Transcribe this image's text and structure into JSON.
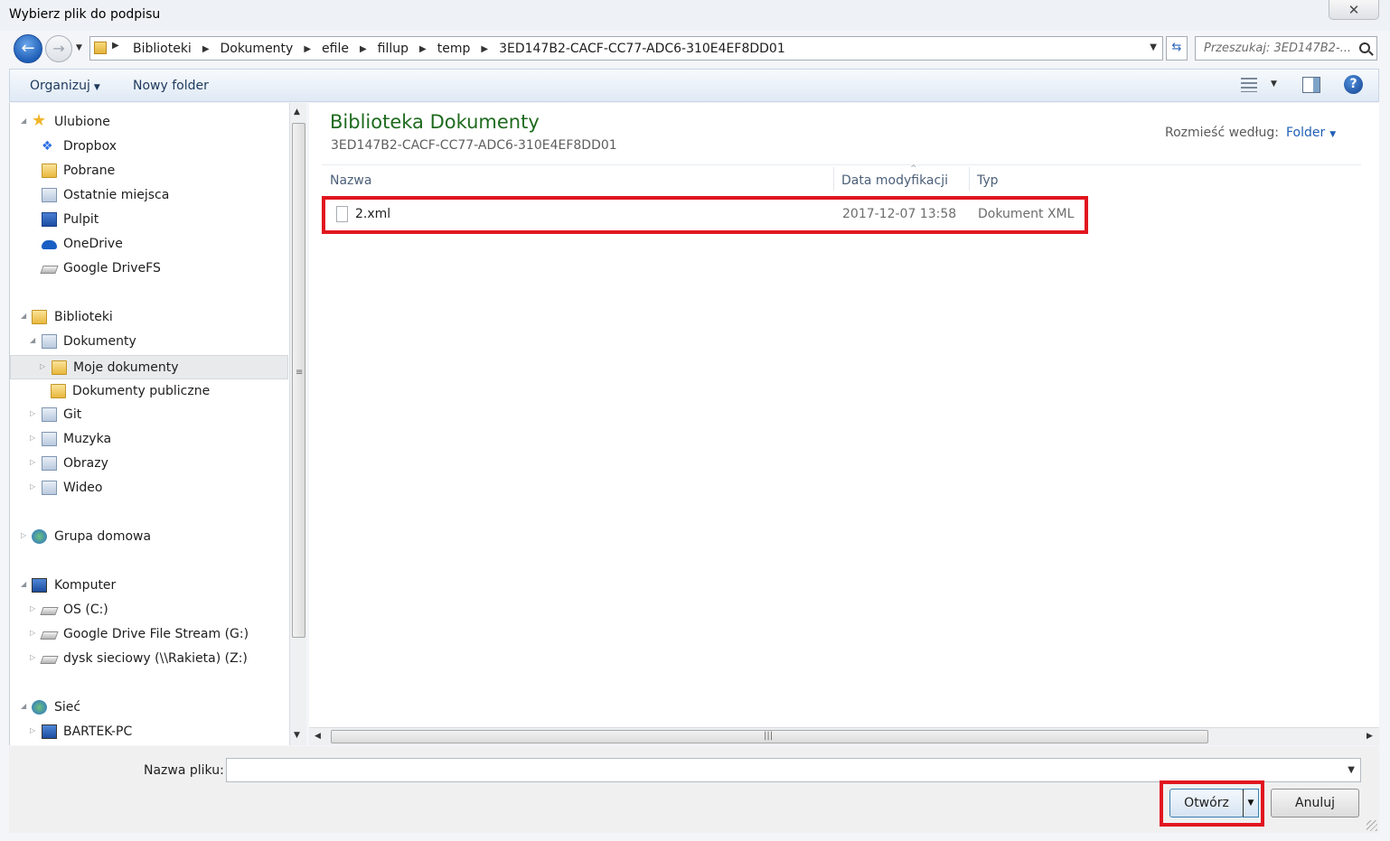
{
  "window": {
    "title": "Wybierz plik do podpisu",
    "close_glyph": "✕"
  },
  "address": {
    "crumbs": [
      "Biblioteki",
      "Dokumenty",
      "efile",
      "fillup",
      "temp",
      "3ED147B2-CACF-CC77-ADC6-310E4EF8DD01"
    ],
    "search_placeholder": "Przeszukaj: 3ED147B2-..."
  },
  "toolbar": {
    "organize_label": "Organizuj",
    "new_folder_label": "Nowy folder"
  },
  "nav": {
    "favorites": {
      "label": "Ulubione",
      "items": [
        "Dropbox",
        "Pobrane",
        "Ostatnie miejsca",
        "Pulpit",
        "OneDrive",
        "Google DriveFS"
      ]
    },
    "libraries": {
      "label": "Biblioteki",
      "documents": "Dokumenty",
      "my_docs": "Moje dokumenty",
      "public_docs": "Dokumenty publiczne",
      "items": [
        "Git",
        "Muzyka",
        "Obrazy",
        "Wideo"
      ]
    },
    "homegroup": "Grupa domowa",
    "computer": {
      "label": "Komputer",
      "items": [
        "OS (C:)",
        "Google Drive File Stream (G:)",
        "dysk sieciowy (\\\\Rakieta) (Z:)"
      ]
    },
    "network": {
      "label": "Sieć",
      "items": [
        "BARTEK-PC"
      ]
    }
  },
  "content": {
    "title": "Biblioteka Dokumenty",
    "subtitle": "3ED147B2-CACF-CC77-ADC6-310E4EF8DD01",
    "arrange_label": "Rozmieść według:",
    "arrange_value": "Folder",
    "columns": {
      "name": "Nazwa",
      "date": "Data modyfikacji",
      "type": "Typ"
    },
    "files": [
      {
        "name": "2.xml",
        "date": "2017-12-07 13:58",
        "type": "Dokument XML"
      }
    ]
  },
  "bottom": {
    "filename_label": "Nazwa pliku:",
    "filename_value": "",
    "open_label": "Otwórz",
    "cancel_label": "Anuluj"
  },
  "colors": {
    "highlight": "#e1161f",
    "library_title": "#1e6a1e",
    "link": "#1f5fb6"
  }
}
